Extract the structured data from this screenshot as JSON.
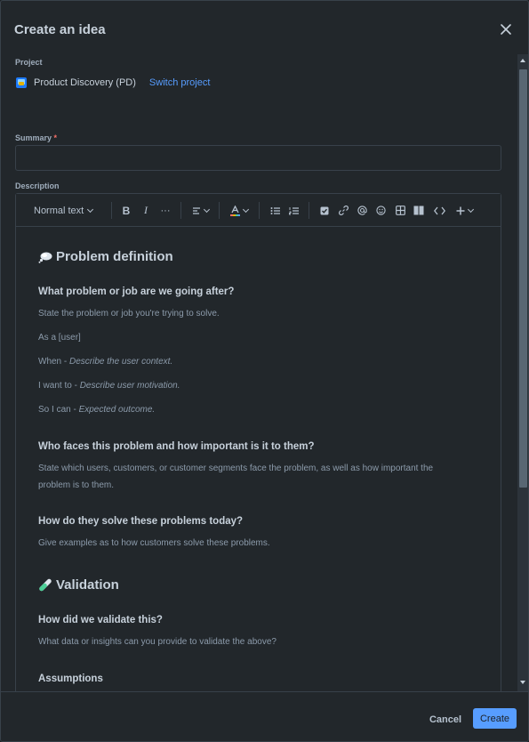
{
  "dialog": {
    "title": "Create an idea",
    "close_icon": "close-icon"
  },
  "project": {
    "label": "Project",
    "name": "Product Discovery (PD)",
    "switch_label": "Switch project",
    "icon": "project-avatar-icon"
  },
  "summary": {
    "label": "Summary",
    "required_marker": "*",
    "value": ""
  },
  "description": {
    "label": "Description",
    "toolbar": {
      "text_style": "Normal text",
      "bold": "B",
      "italic": "I",
      "more": "···",
      "icons": [
        "bold-icon",
        "italic-icon",
        "more-formatting-icon",
        "align-icon",
        "text-color-icon",
        "bullet-list-icon",
        "numbered-list-icon",
        "action-item-icon",
        "link-icon",
        "mention-icon",
        "emoji-icon",
        "table-icon",
        "layout-icon",
        "code-icon",
        "insert-plus-icon"
      ]
    },
    "content": {
      "h_problem": "Problem definition",
      "q1": "What problem or job are we going after?",
      "q1_p1": "State the problem or job you're trying to solve.",
      "q1_p2": "As a [user]",
      "q1_p3_prefix": "When - ",
      "q1_p3_italic": "Describe the user context.",
      "q1_p4_prefix": "I want to - ",
      "q1_p4_italic": "Describe user motivation.",
      "q1_p5_prefix": "So I can - ",
      "q1_p5_italic": "Expected outcome.",
      "q2": "Who faces this problem and how important is it to them?",
      "q2_p1": "State which users, customers, or customer segments face the problem, as well as how important the problem is to them.",
      "q3": "How do they solve these problems today?",
      "q3_p1": "Give examples as to how customers solve these problems.",
      "h_validation": "Validation",
      "q4": "How did we validate this?",
      "q4_p1": "What data or insights can you provide to validate the above?",
      "q5": "Assumptions"
    }
  },
  "footer": {
    "cancel_label": "Cancel",
    "create_label": "Create"
  },
  "colors": {
    "background": "#22272b",
    "border": "#38414a",
    "text": "#c7d1db",
    "subtle_text": "#8c9bab",
    "link": "#579dff",
    "primary_button": "#579dff",
    "required": "#f87168"
  }
}
